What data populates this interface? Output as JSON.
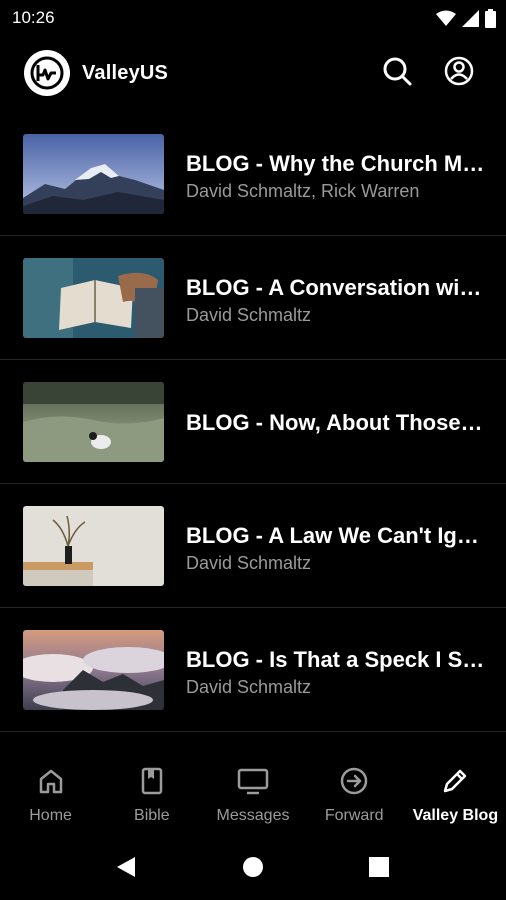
{
  "status_bar": {
    "time": "10:26",
    "icons": [
      "wifi-icon",
      "signal-icon",
      "battery-icon"
    ]
  },
  "app_bar": {
    "title": "ValleyUS",
    "actions": [
      "search-icon",
      "account-icon"
    ]
  },
  "blogs": [
    {
      "title": "BLOG - Why the Church M…",
      "author": "David Schmaltz, Rick Warren",
      "thumb": "mountain-image"
    },
    {
      "title": "BLOG - A Conversation wit…",
      "author": "David Schmaltz",
      "thumb": "bible-reading-image"
    },
    {
      "title": "BLOG - Now, About Those…",
      "author": "",
      "thumb": "field-lamb-image"
    },
    {
      "title": "BLOG - A Law We Can't Ig…",
      "author": "David Schmaltz",
      "thumb": "vase-image"
    },
    {
      "title": "BLOG - Is That a Speck I S…",
      "author": "David Schmaltz",
      "thumb": "clouds-image"
    }
  ],
  "bottom_nav": [
    {
      "label": "Home",
      "icon": "home-icon"
    },
    {
      "label": "Bible",
      "icon": "bible-icon"
    },
    {
      "label": "Messages",
      "icon": "monitor-icon"
    },
    {
      "label": "Forward",
      "icon": "arrow-circle-icon"
    },
    {
      "label": "Valley Blog",
      "icon": "pencil-icon",
      "active": true
    }
  ],
  "colors": {
    "background": "#000000",
    "text": "#ffffff",
    "secondary_text": "#9a9a9a",
    "divider": "#262626"
  }
}
